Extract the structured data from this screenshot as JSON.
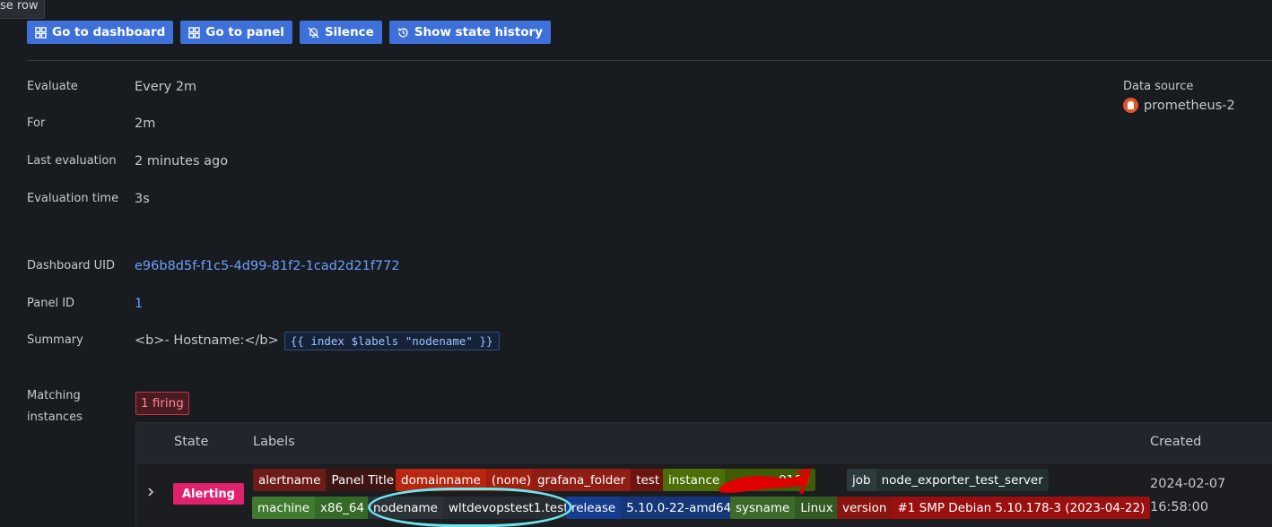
{
  "tooltip": "se row",
  "toolbar": {
    "go_dashboard": "Go to dashboard",
    "go_panel": "Go to panel",
    "silence": "Silence",
    "state_history": "Show state history"
  },
  "details": {
    "evaluate": {
      "label": "Evaluate",
      "value": "Every 2m"
    },
    "for": {
      "label": "For",
      "value": "2m"
    },
    "last_evaluation": {
      "label": "Last evaluation",
      "value": "2 minutes ago"
    },
    "evaluation_time": {
      "label": "Evaluation time",
      "value": "3s"
    },
    "dashboard_uid": {
      "label": "Dashboard UID",
      "value": "e96b8d5f-f1c5-4d99-81f2-1cad2d21f772"
    },
    "panel_id": {
      "label": "Panel ID",
      "value": "1"
    },
    "summary": {
      "label": "Summary",
      "value": "<b>- Hostname:</b>",
      "code": "{{ index $labels \"nodename\" }}"
    }
  },
  "datasource": {
    "label": "Data source",
    "value": "prometheus-2",
    "icon": "prometheus-icon"
  },
  "matching": {
    "label": "Matching instances",
    "badge": "1 firing"
  },
  "table": {
    "headers": {
      "state": "State",
      "labels": "Labels",
      "created": "Created"
    },
    "row": {
      "state": "Alerting",
      "created_date": "2024-02-07",
      "created_time": "16:58:00",
      "labels": [
        {
          "key": "alertname",
          "value": "Panel Title",
          "kc": "#6e1b17",
          "vc": "#3d1512"
        },
        {
          "key": "domainname",
          "value": "(none)",
          "kc": "#b8260f",
          "vc": "#a11f0c"
        },
        {
          "key": "grafana_folder",
          "value": "test",
          "kc": "#8f1d14",
          "vc": "#6c150f"
        },
        {
          "key": "instance",
          "value": "9100",
          "kc": "#4b6f06",
          "vc": "#3f5b05"
        },
        {
          "key": "job",
          "value": "node_exporter_test_server",
          "kc": "#2d3b3f",
          "vc": "#23302f"
        },
        {
          "key": "machine",
          "value": "x86_64",
          "kc": "#3f7a2e",
          "vc": "#356926"
        },
        {
          "key": "nodename",
          "value": "wltdevopstest1.test",
          "kc": "#2b3238",
          "vc": "#262c31"
        },
        {
          "key": "release",
          "value": "5.10.0-22-amd64",
          "kc": "#173d8f",
          "vc": "#153679"
        },
        {
          "key": "sysname",
          "value": "Linux",
          "kc": "#3d6a2a",
          "vc": "#325823"
        },
        {
          "key": "version",
          "value": "#1 SMP Debian 5.10.178-3 (2023-04-22)",
          "kc": "#8a140f",
          "vc": "#9a1010"
        }
      ]
    }
  },
  "colors": {
    "primary": "#3d71d9",
    "alerting": "#e0226e",
    "link": "#6e9fff"
  }
}
